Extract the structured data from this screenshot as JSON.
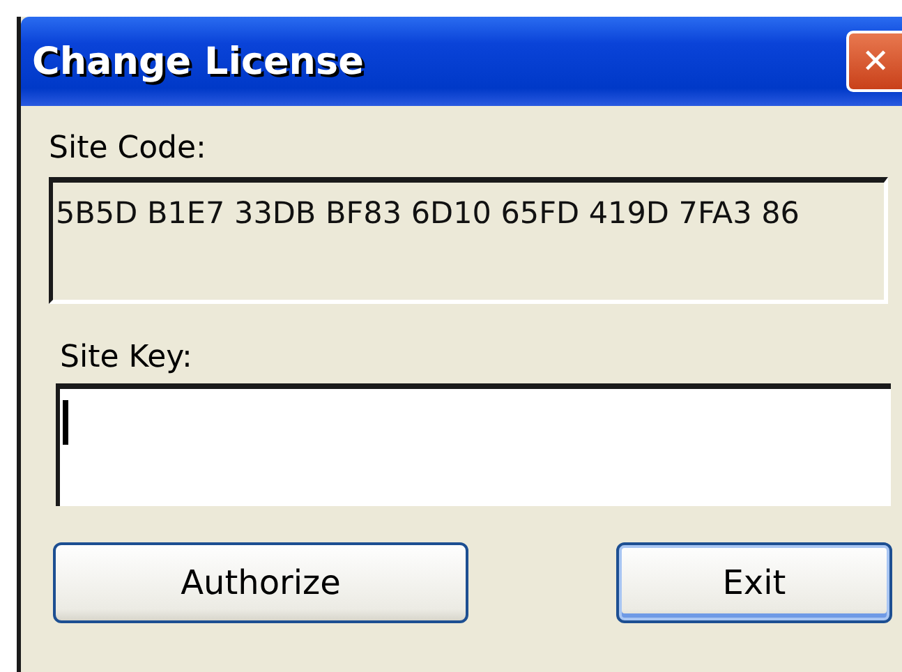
{
  "window": {
    "title": "Change License",
    "close": "✕"
  },
  "site_code": {
    "label": "Site Code:",
    "value": "5B5D B1E7 33DB BF83 6D10 65FD 419D 7FA3 86"
  },
  "site_key": {
    "label": "Site Key:",
    "focused": true
  },
  "buttons": [
    {
      "label": "Authorize",
      "default": false
    },
    {
      "label": "Exit",
      "default": true
    }
  ]
}
